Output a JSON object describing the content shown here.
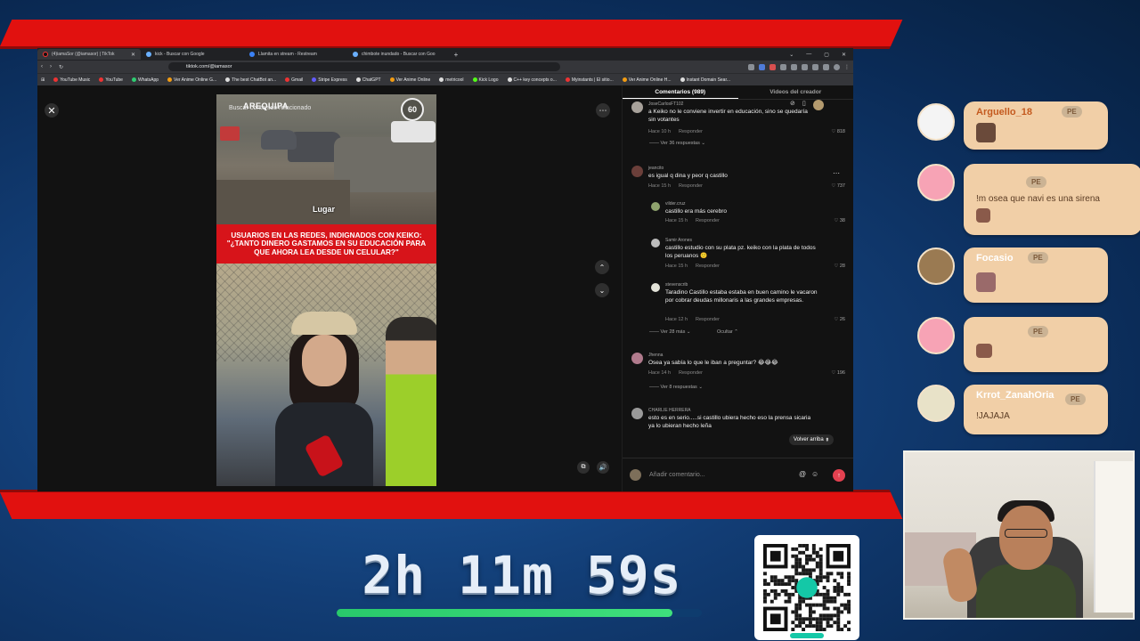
{
  "browser": {
    "tabs": [
      {
        "label": "(4)iamaSor (@iamasor) | TikTok",
        "active": true
      },
      {
        "label": "kick - Buscar con Google",
        "active": false
      },
      {
        "label": "Llamita en stream - Restream",
        "active": false
      },
      {
        "label": "chimbote inundado - Buscar con Goo",
        "active": false
      }
    ],
    "url": "tiktok.com/@iamasor",
    "bookmarks": [
      "YouTube Music",
      "YouTube",
      "WhatsApp",
      "Ver Anime Online G...",
      "The best ChatBot an...",
      "Gmail",
      "Stripe Express",
      "ChatGPT",
      "Ver Anime Online",
      "metricool",
      "Kick Logo",
      "C++ key concepts o...",
      "Myinstants | El sitio...",
      "Ver Anime Online H...",
      "Instant Domain Sear..."
    ]
  },
  "video": {
    "search_overlay": "Buscar contenido relacionado",
    "city": "AREQUIPA",
    "logo": "60",
    "place_label": "Lugar",
    "headline": "USUARIOS EN LAS REDES, INDIGNADOS CON KEIKO: \"¿TANTO DINERO GASTAMOS EN SU EDUCACIÓN PARA QUE AHORA LEA DESDE UN CELULAR?\""
  },
  "comments": {
    "tab_comments": "Comentarios (989)",
    "tab_creator": "Videos del creador",
    "items": [
      {
        "user": "JoseCarlosFT102",
        "text": "a Keiko no le conviene invertir en educación, sino se quedaría sin votantes",
        "time": "Hace 10 h",
        "reply": "Responder",
        "likes": "818"
      },
      {
        "user": "jeancito",
        "text": "es igual q dina y peor q castillo",
        "time": "Hace 15 h",
        "reply": "Responder",
        "likes": "737"
      },
      {
        "user": "vilder.cruz",
        "text": "castillo era más cerebro",
        "time": "Hace 15 h",
        "reply": "Responder",
        "likes": "38"
      },
      {
        "user": "Samir Arones",
        "text": "castillo estudio con su plata pz. keiko con la plata de todos los peruanos 🙂",
        "time": "Hace 15 h",
        "reply": "Responder",
        "likes": "28"
      },
      {
        "user": "stevenscrib",
        "text": "Taradino Castillo estaba estaba en buen camino le vacaron por cobrar deudas millonaris a las grandes empresas.",
        "time": "Hace 12 h",
        "reply": "Responder",
        "likes": "26"
      },
      {
        "user": "Jhenna",
        "text": "Osea ya sabía lo que le iban a preguntar? 😂😂😂",
        "time": "Hace 14 h",
        "reply": "Responder",
        "likes": "196"
      },
      {
        "user": "CHARLIE HERRERA",
        "text": "esto es en serio.....si castillo ubiera hecho eso la prensa sicaria ya lo ubieran hecho leña",
        "time": "",
        "reply": "",
        "likes": ""
      }
    ],
    "view_more": [
      "Ver 36 respuestas",
      "Ver 28 más",
      "Ver 8 respuestas"
    ],
    "hide": "Ocultar",
    "back_to_top": "Volver arriba",
    "input_placeholder": "Añadir comentario..."
  },
  "chat": [
    {
      "name": "Arguello_18",
      "badge": "PE",
      "message": "",
      "sticker": true
    },
    {
      "name": "",
      "badge": "PE",
      "message": "!m osea que navi es una sirena",
      "sticker": true
    },
    {
      "name": "Focasio",
      "badge": "PE",
      "message": "",
      "sticker": true
    },
    {
      "name": "",
      "badge": "PE",
      "message": "",
      "sticker": true
    },
    {
      "name": "Krrot_ZanahOria",
      "badge": "PE",
      "message": "!JAJAJA",
      "sticker": false
    }
  ],
  "timer": {
    "text": "2h 11m 59s",
    "progress": 0.92
  },
  "colors": {
    "stripe": "#e1110f",
    "progress": "#2fd16f",
    "chat_bubble": "#f1cfa7",
    "chat_name": "#c45a1f",
    "tiktok_accent": "#e34150"
  }
}
